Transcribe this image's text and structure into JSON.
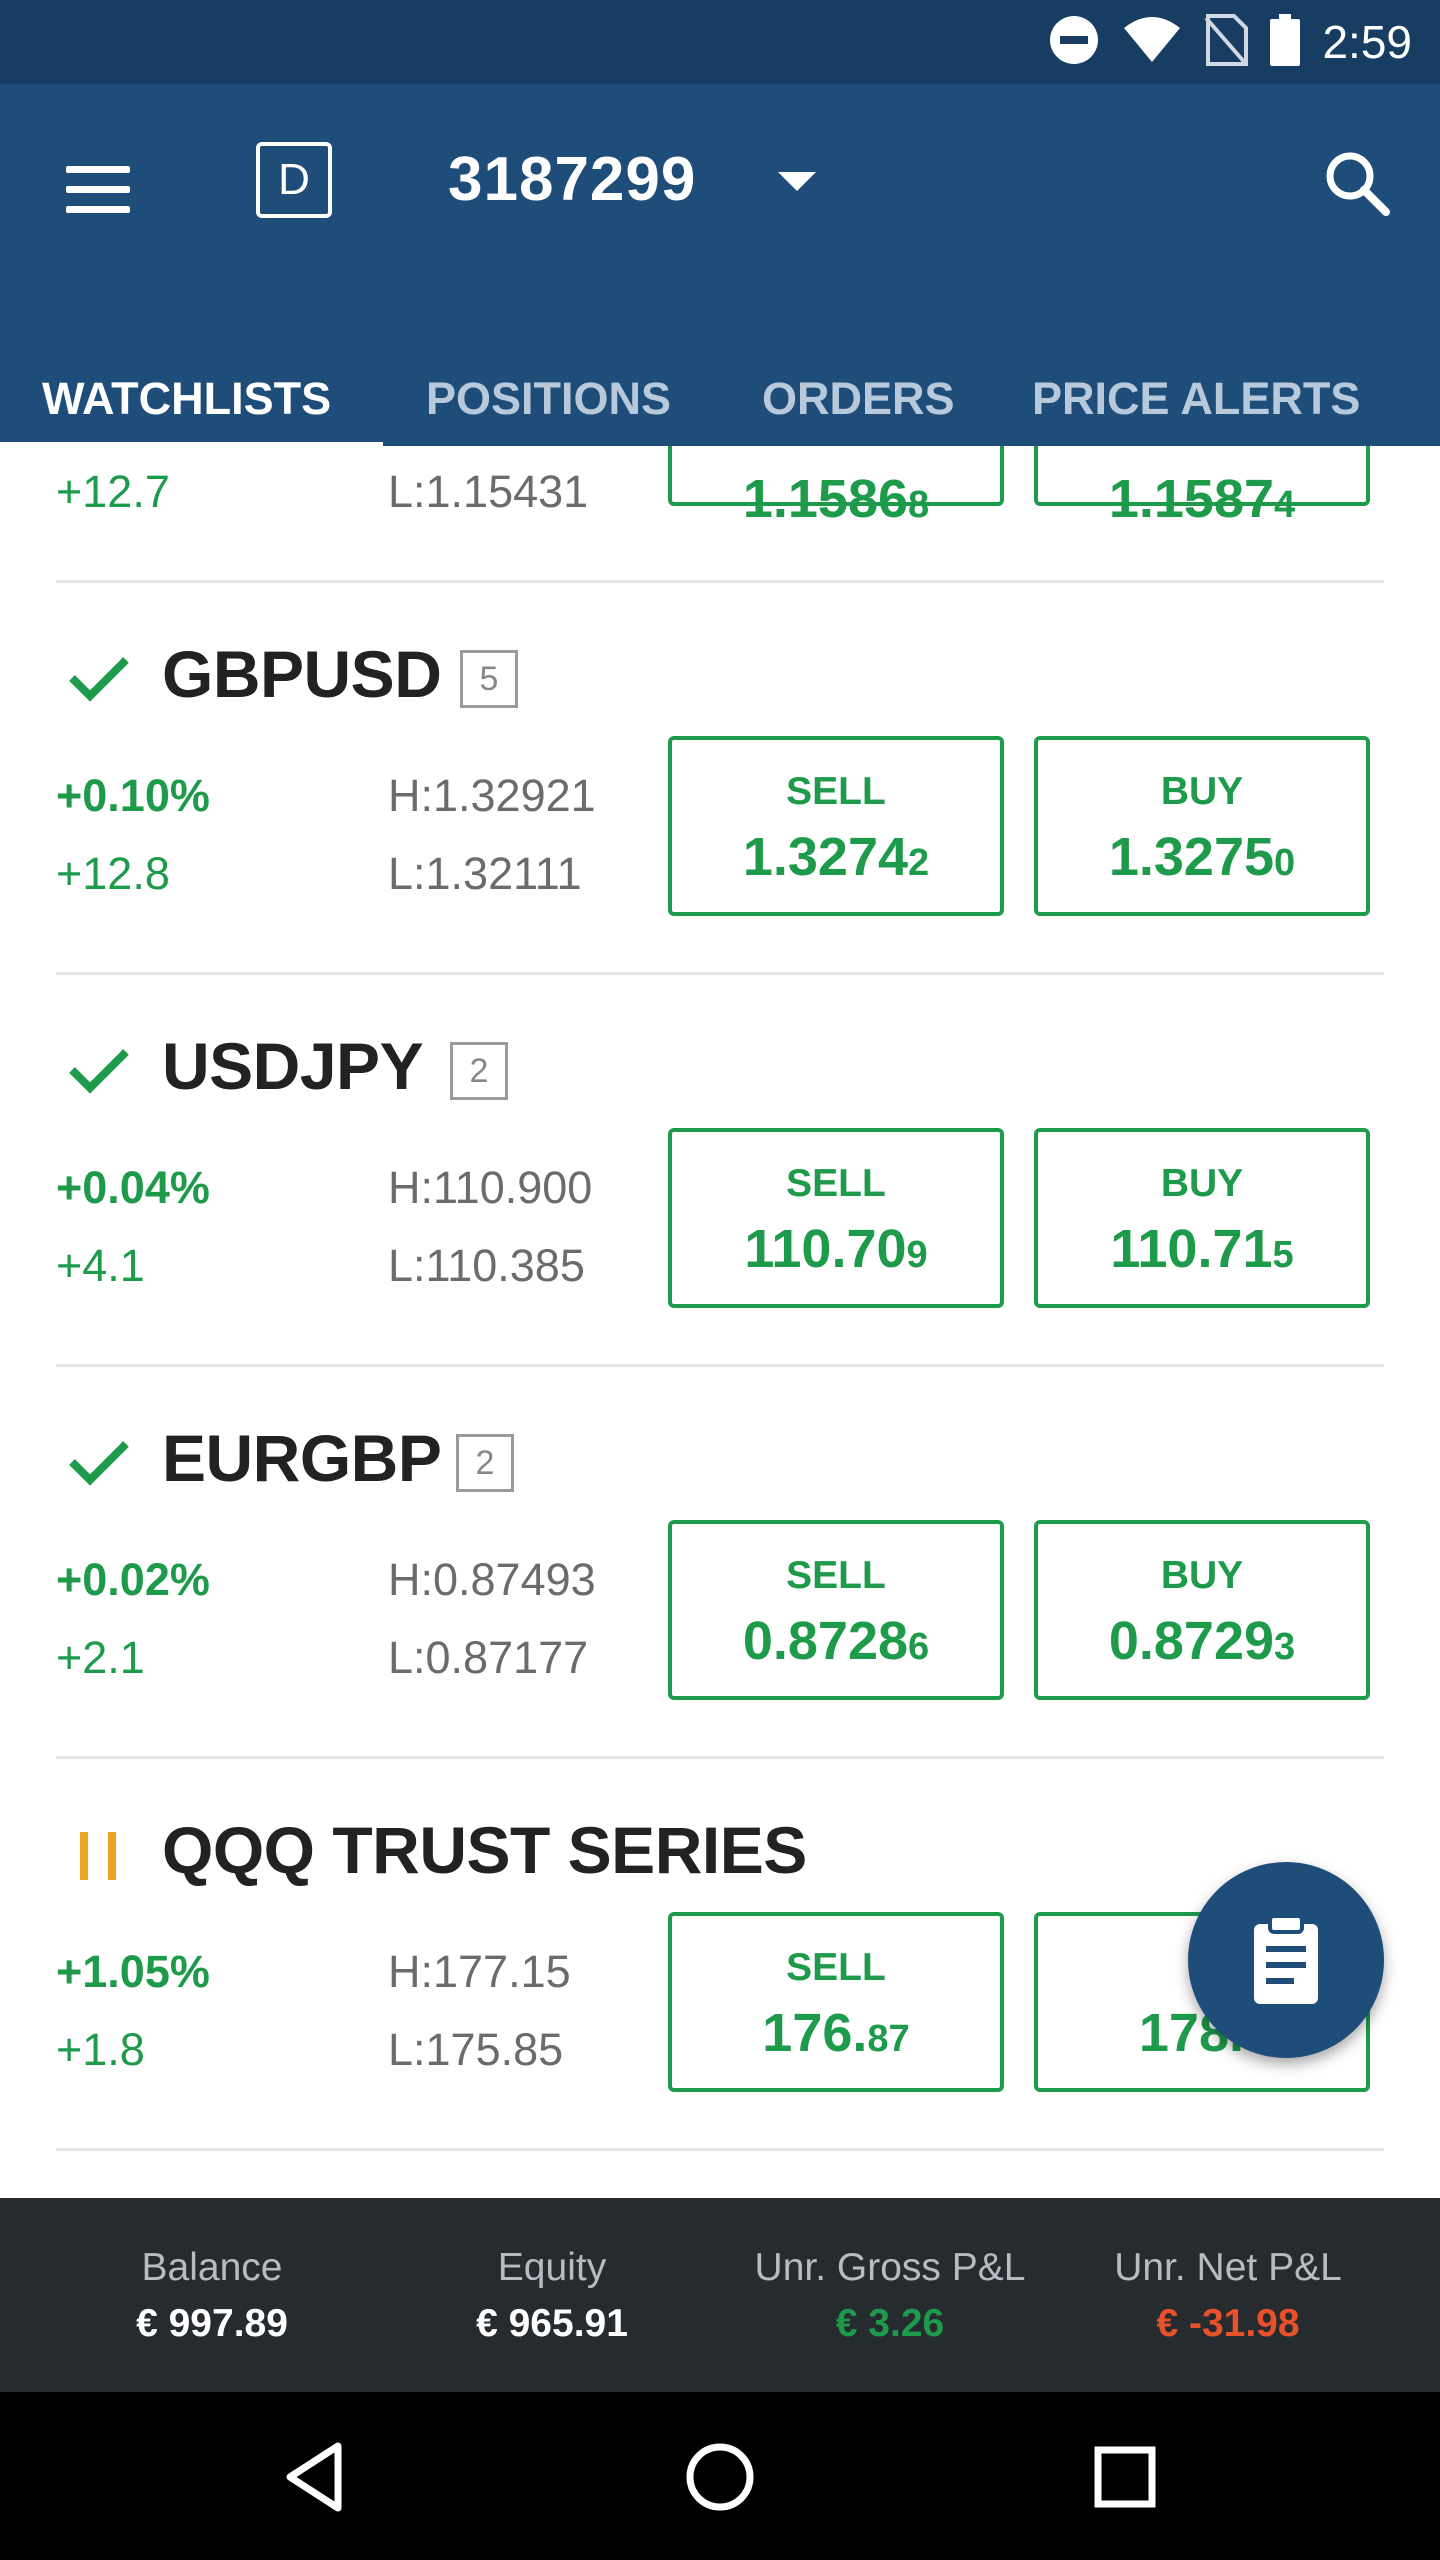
{
  "status_bar": {
    "time": "2:59",
    "icons": [
      "do-not-disturb-icon",
      "wifi-icon",
      "no-sim-icon",
      "battery-icon"
    ]
  },
  "header": {
    "mode_badge": "D",
    "account_number": "3187299"
  },
  "tabs": [
    {
      "label": "WATCHLISTS",
      "active": true
    },
    {
      "label": "POSITIONS",
      "active": false
    },
    {
      "label": "ORDERS",
      "active": false
    },
    {
      "label": "PRICE ALERTS",
      "active": false
    }
  ],
  "partial_row": {
    "change": "+12.7",
    "low": "L:1.15431",
    "sell_price_main": "1.1586",
    "sell_price_small": "8",
    "buy_price_main": "1.1587",
    "buy_price_small": "4"
  },
  "instruments": [
    {
      "symbol": "GBPUSD",
      "status": "check",
      "count": "5",
      "pct_change": "+0.10%",
      "change": "+12.8",
      "high": "H:1.32921",
      "low": "L:1.32111",
      "sell_label": "SELL",
      "sell_main": "1.3274",
      "sell_small": "2",
      "buy_label": "BUY",
      "buy_main": "1.3275",
      "buy_small": "0"
    },
    {
      "symbol": "USDJPY",
      "status": "check",
      "count": "2",
      "pct_change": "+0.04%",
      "change": "+4.1",
      "high": "H:110.900",
      "low": "L:110.385",
      "sell_label": "SELL",
      "sell_main": "110.70",
      "sell_small": "9",
      "buy_label": "BUY",
      "buy_main": "110.71",
      "buy_small": "5"
    },
    {
      "symbol": "EURGBP",
      "status": "check",
      "count": "2",
      "pct_change": "+0.02%",
      "change": "+2.1",
      "high": "H:0.87493",
      "low": "L:0.87177",
      "sell_label": "SELL",
      "sell_main": "0.8728",
      "sell_small": "6",
      "buy_label": "BUY",
      "buy_main": "0.8729",
      "buy_small": "3"
    },
    {
      "symbol": "QQQ TRUST SERIES",
      "status": "paused",
      "pct_change": "+1.05%",
      "change": "+1.8",
      "high": "H:177.15",
      "low": "L:175.85",
      "sell_label": "SELL",
      "sell_main": "176.",
      "sell_small": "87",
      "buy_label": "B",
      "buy_main": "178.",
      "buy_small": "5"
    }
  ],
  "fab": {
    "icon": "clipboard-icon"
  },
  "summary": [
    {
      "label": "Balance",
      "value": "€ 997.89",
      "tone": "neutral"
    },
    {
      "label": "Equity",
      "value": "€ 965.91",
      "tone": "neutral"
    },
    {
      "label": "Unr. Gross P&L",
      "value": "€ 3.26",
      "tone": "positive"
    },
    {
      "label": "Unr. Net P&L",
      "value": "€ -31.98",
      "tone": "negative"
    }
  ],
  "colors": {
    "status_bar": "#173e62",
    "app_bar": "#1f4d7a",
    "positive": "#1e9a4b",
    "negative": "#e8512a",
    "paused": "#e7a521",
    "summary_bg": "#262b30"
  },
  "nav": {
    "icons": [
      "back-icon",
      "home-icon",
      "recents-icon"
    ]
  }
}
